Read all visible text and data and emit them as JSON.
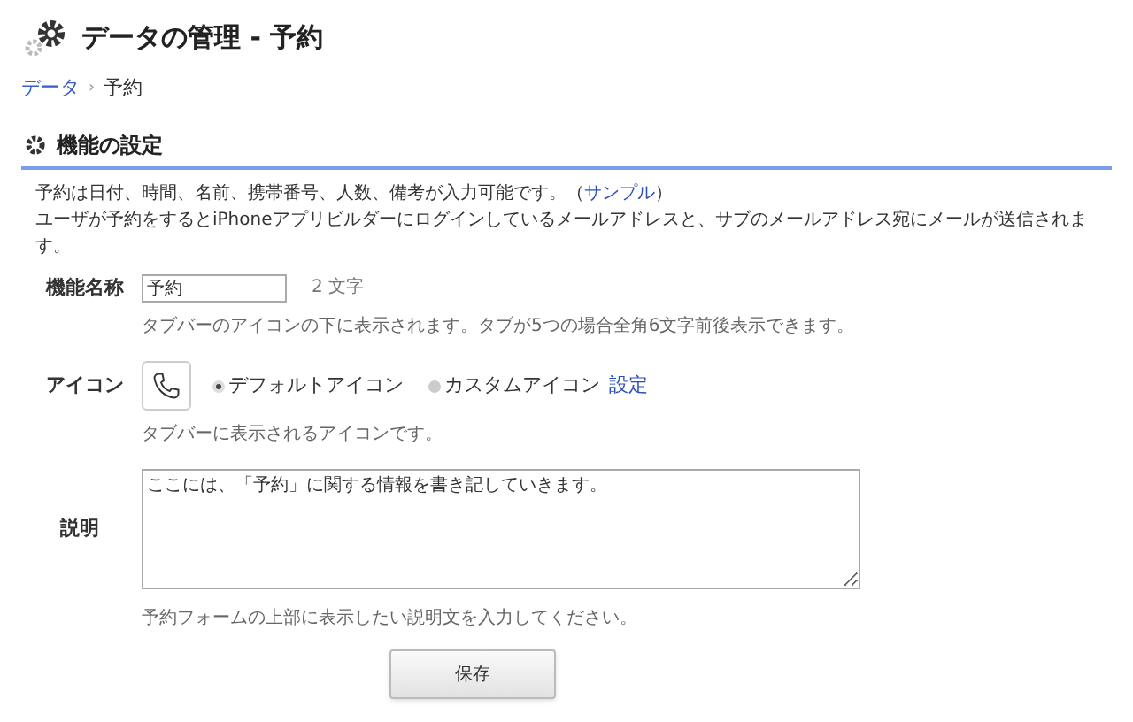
{
  "page_title": "データの管理 - 予約",
  "breadcrumb": [
    {
      "label": "データ",
      "kind": "link"
    },
    {
      "label": "予約",
      "kind": "current"
    }
  ],
  "breadcrumb_separator": "›",
  "section": {
    "title": "機能の設定"
  },
  "description": {
    "line1": "予約は日付、時間、名前、携帯番号、人数、備考が入力可能です。（",
    "sample_link": "サンプル",
    "line1_end": "）",
    "line2": "ユーザが予約をするとiPhoneアプリビルダーにログインしているメールアドレスと、サブのメールアドレス宛にメールが送信されます。"
  },
  "name_field": {
    "label": "機能名称",
    "value": "予約",
    "count": "2 文字",
    "hint": "タブバーのアイコンの下に表示されます。タブが5つの場合全角6文字前後表示できます。"
  },
  "icon_field": {
    "label": "アイコン",
    "options": [
      {
        "label": "デフォルトアイコン",
        "selected": true
      },
      {
        "label": "カスタムアイコン",
        "selected": false
      }
    ],
    "settings_link": "設定",
    "hint": "タブバーに表示されるアイコンです。"
  },
  "description_field": {
    "label": "説明",
    "value": "ここには、「予約」に関する情報を書き記していきます。",
    "hint": "予約フォームの上部に表示したい説明文を入力してください。"
  },
  "save_button": "保存"
}
